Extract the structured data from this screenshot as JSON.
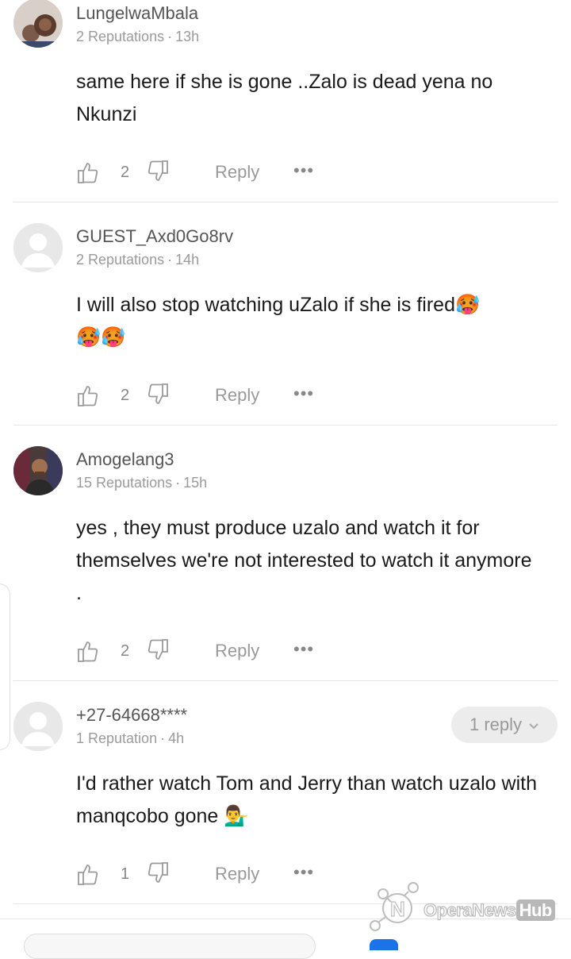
{
  "comments": [
    {
      "username": "LungelwaMbala",
      "reputation": "2 Reputations",
      "time": "13h",
      "text": "same here if she is gone ..Zalo is dead yena no Nkunzi",
      "likes": "2",
      "reply_label": "Reply",
      "more_label": "•••"
    },
    {
      "username": "GUEST_Axd0Go8rv",
      "reputation": "2 Reputations",
      "time": "14h",
      "text": "I will also stop watching uZalo if she is fired",
      "emoji": "🥵",
      "emoji2": "🥵🥵",
      "likes": "2",
      "reply_label": "Reply",
      "more_label": "•••"
    },
    {
      "username": "Amogelang3",
      "reputation": "15 Reputations",
      "time": "15h",
      "text": "yes , they must produce uzalo and watch it for themselves we're not interested to watch it anymore .",
      "likes": "2",
      "reply_label": "Reply",
      "more_label": "•••"
    },
    {
      "username": "+27-64668****",
      "reputation": "1 Reputation",
      "time": "4h",
      "text": "I'd rather watch Tom and Jerry than watch uzalo with manqcobo gone",
      "emoji": "💁‍♂️",
      "likes": "1",
      "reply_label": "Reply",
      "more_label": "•••",
      "replies_label": "1 reply"
    }
  ],
  "watermark": {
    "brand": "OperaNews",
    "hub": "Hub"
  },
  "icons": {
    "like": "thumbs-up-outline-icon",
    "dislike": "thumbs-down-outline-icon",
    "more": "more-horizontal-icon",
    "chevron": "chevron-down-icon"
  }
}
